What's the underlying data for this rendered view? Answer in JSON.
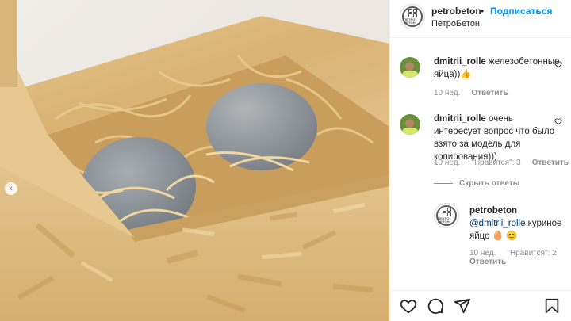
{
  "post": {
    "username": "petrobeton",
    "separator": "•",
    "follow_label": "Подписаться",
    "subtitle": "ПетроБетон",
    "logo_text": "ПЕТРО БЕТОН"
  },
  "comments": [
    {
      "username": "dmitrii_rolle",
      "text": "железобетонные яйца))👍",
      "time": "10 нед.",
      "reply_label": "Ответить"
    },
    {
      "username": "dmitrii_rolle",
      "text": "очень интересует вопрос что было взято за модель для копирования)))",
      "time": "10 нед.",
      "likes": "\"Нравится\": 3",
      "reply_label": "Ответить",
      "hide_replies_label": "Скрыть ответы",
      "replies": [
        {
          "username": "petrobeton",
          "mention": "@dmitrii_rolle",
          "text": "куриное яйцо 🥚 😊",
          "time": "10 нед.",
          "likes": "\"Нравится\": 2",
          "reply_label": "Ответить"
        }
      ]
    }
  ],
  "icons": {
    "like": "heart-icon",
    "comment": "comment-icon",
    "share": "share-icon",
    "save": "bookmark-icon",
    "carousel": "carousel-indicator-icon"
  },
  "colors": {
    "accent": "#0095f6",
    "muted": "#8e8e8e",
    "text": "#262626"
  }
}
